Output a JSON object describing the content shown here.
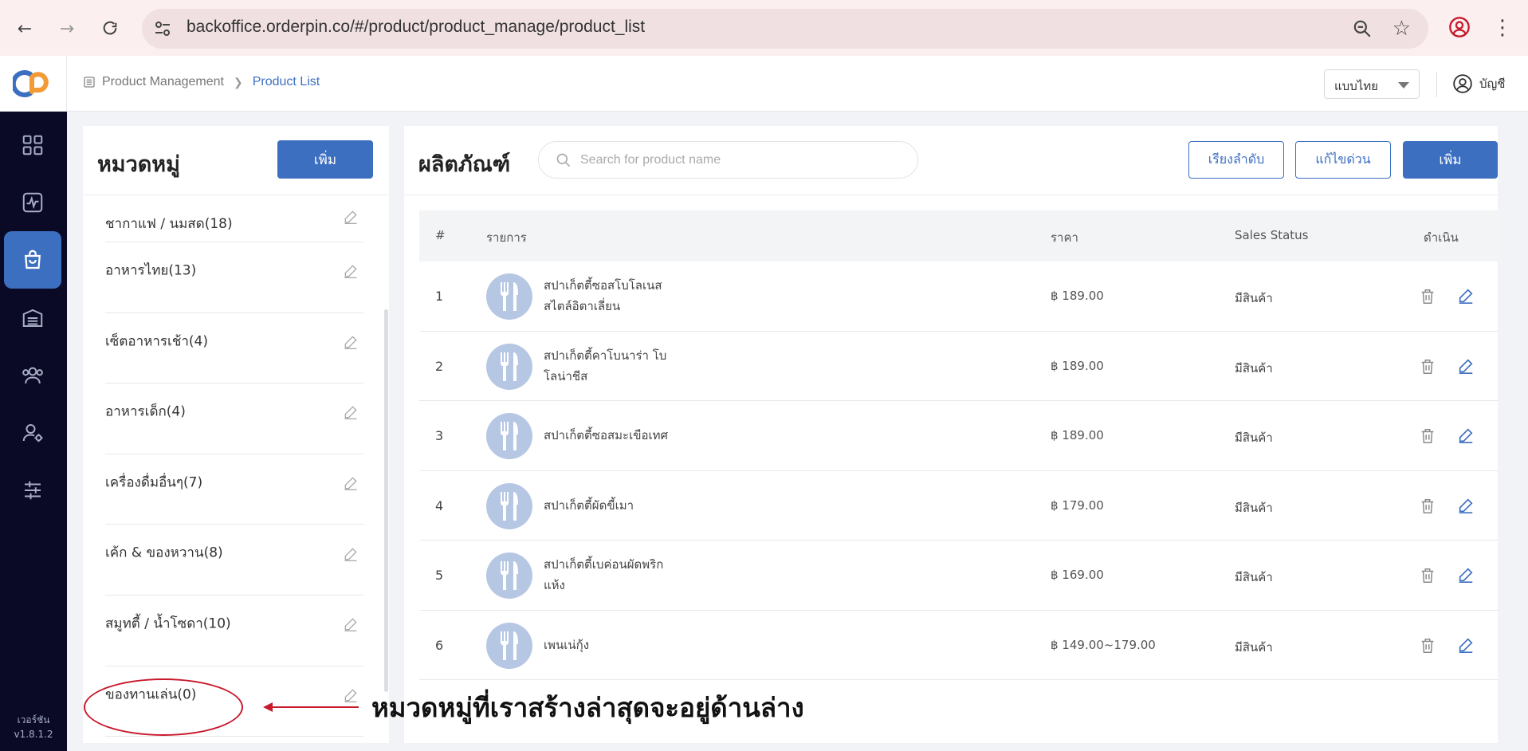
{
  "browser": {
    "url": "backoffice.orderpin.co/#/product/product_manage/product_list"
  },
  "app": {
    "version_label": "เวอร์ชัน",
    "version": "v1.8.1.2"
  },
  "header": {
    "breadcrumb": [
      "Product Management",
      "Product List"
    ],
    "language": "แบบไทย",
    "account_label": "บัญชี"
  },
  "categories": {
    "title": "หมวดหมู่",
    "add_label": "เพิ่ม",
    "items": [
      "ชากาแฟ / นมสด(18)",
      "อาหารไทย(13)",
      "เซ็ตอาหารเช้า(4)",
      "อาหารเด็ก(4)",
      "เครื่องดื่มอื่นๆ(7)",
      "เค้ก & ของหวาน(8)",
      "สมูทตี้ / น้ำโซดา(10)",
      "ของทานเล่น(0)"
    ]
  },
  "products": {
    "title": "ผลิตภัณฑ์",
    "search_placeholder": "Search for product name",
    "sort_label": "เรียงลำดับ",
    "quick_edit_label": "แก้ไขด่วน",
    "add_label": "เพิ่ม",
    "columns": [
      "#",
      "รายการ",
      "ราคา",
      "Sales Status",
      "ดำเนิน"
    ],
    "rows": [
      {
        "num": "1",
        "name": "สปาเก็ตตี้ซอสโบโลเนส สไตล์อิตาเลี่ยน",
        "price": "฿ 189.00",
        "status": "มีสินค้า"
      },
      {
        "num": "2",
        "name": "สปาเก็ตตี้คาโบนาร่า โบโลน่าชีส",
        "price": "฿ 189.00",
        "status": "มีสินค้า"
      },
      {
        "num": "3",
        "name": "สปาเก็ตตี้ซอสมะเขือเทศ",
        "price": "฿ 189.00",
        "status": "มีสินค้า"
      },
      {
        "num": "4",
        "name": "สปาเก็ตตี้ผัดขี้เมา",
        "price": "฿ 179.00",
        "status": "มีสินค้า"
      },
      {
        "num": "5",
        "name": "สปาเก็ตตี้เบค่อนผัดพริก แห้ง",
        "price": "฿ 169.00",
        "status": "มีสินค้า"
      },
      {
        "num": "6",
        "name": "เพนเน่กุ้ง",
        "price": "฿ 149.00~179.00",
        "status": "มีสินค้า"
      }
    ]
  },
  "annotation": {
    "text": "หมวดหมู่ที่เราสร้างล่าสุดจะอยู่ด้านล่าง"
  },
  "colors": {
    "accent": "#3d6fc1",
    "sidebar": "#0a0a26",
    "annotation": "#c8192d"
  }
}
